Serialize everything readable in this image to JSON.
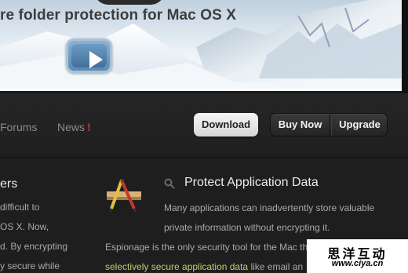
{
  "hero": {
    "title": "re folder protection for Mac OS X",
    "play_icon": "play-icon"
  },
  "nav": {
    "forums": "Forums",
    "news": "News",
    "news_badge": "!",
    "download": "Download",
    "buy_now": "Buy Now",
    "upgrade": "Upgrade"
  },
  "left_column": {
    "heading": "ers",
    "lines": [
      "difficult to",
      "OS X. Now,",
      "d. By encrypting",
      "y secure while"
    ]
  },
  "feature": {
    "icon": "application-pencil-icon",
    "search_icon": "search-icon",
    "heading": "Protect Application Data",
    "lines": [
      "Many applications can inadvertently store valuable",
      "private information without encrypting it.",
      "Espionage is the only security tool for the Mac th",
      "like email an"
    ],
    "highlight": "selectively secure application data"
  },
  "watermark": {
    "chinese": "思洋互动",
    "url": "www.ciya.cn"
  },
  "colors": {
    "accent_red": "#c23a2a",
    "highlight_green": "#b8d46a",
    "background": "#1c1c1c"
  }
}
